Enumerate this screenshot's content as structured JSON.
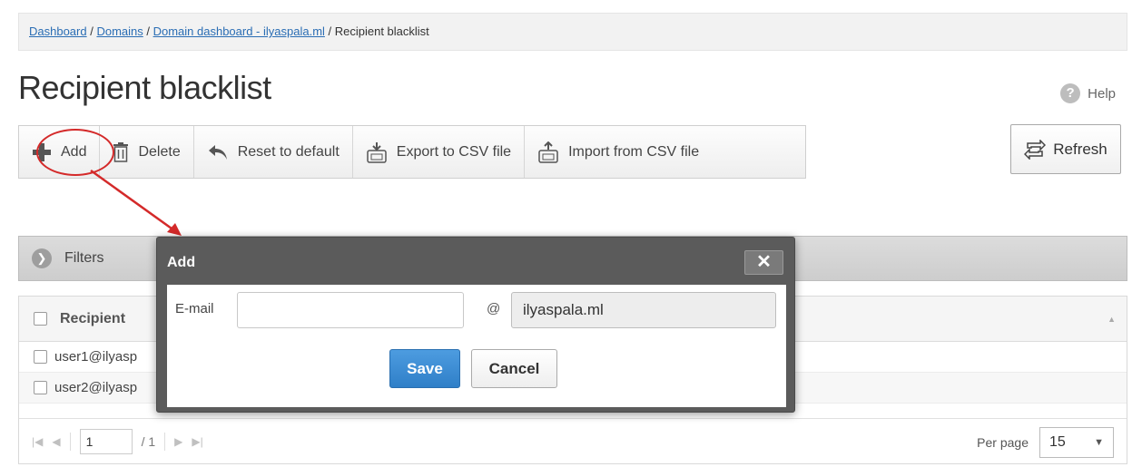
{
  "breadcrumb": {
    "dashboard": "Dashboard",
    "sep1": " / ",
    "domains": "Domains",
    "sep2": " / ",
    "domain_dashboard": "Domain dashboard - ilyaspala.ml",
    "sep3": " / ",
    "current": "Recipient blacklist"
  },
  "page_title": "Recipient blacklist",
  "help_label": "Help",
  "toolbar": {
    "add": "Add",
    "delete": "Delete",
    "reset": "Reset to default",
    "export": "Export to CSV file",
    "import": "Import from CSV file"
  },
  "refresh_label": "Refresh",
  "filters_label": "Filters",
  "grid": {
    "column_recipient": "Recipient",
    "rows": [
      "user1@ilyasp",
      "user2@ilyasp"
    ]
  },
  "pager": {
    "page": "1",
    "of": "/ 1",
    "per_page_label": "Per page",
    "per_page_value": "15"
  },
  "dialog": {
    "title": "Add",
    "close_glyph": "✕",
    "email_label": "E-mail",
    "email_value": "",
    "at": "@",
    "domain_value": "ilyaspala.ml",
    "save": "Save",
    "cancel": "Cancel"
  },
  "colors": {
    "annotation": "#d42a2a",
    "link": "#2a6db4",
    "primary_button": "#2f7fc8"
  },
  "icons": [
    "plus-icon",
    "trash-icon",
    "undo-icon",
    "csv-export-icon",
    "csv-import-icon",
    "refresh-icon",
    "help-icon",
    "chevron-right-circle-icon",
    "close-icon",
    "first-page-icon",
    "prev-page-icon",
    "next-page-icon",
    "last-page-icon",
    "chevron-down-icon",
    "sort-icon"
  ]
}
